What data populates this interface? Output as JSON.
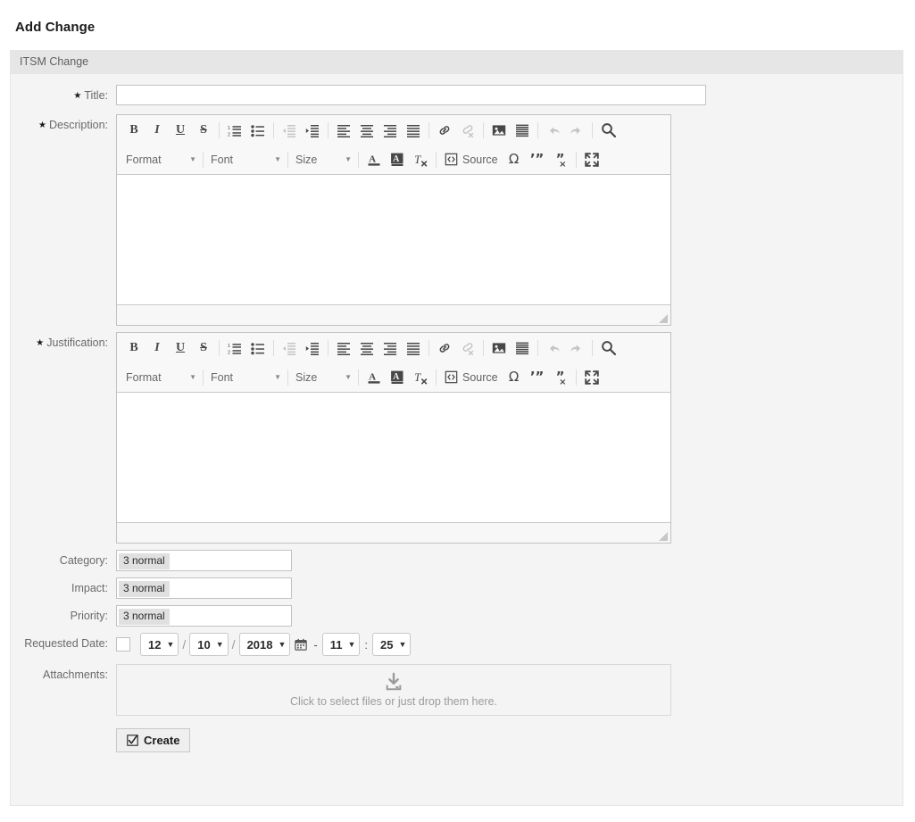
{
  "page": {
    "title": "Add Change"
  },
  "panel": {
    "header": "ITSM Change"
  },
  "fields": {
    "title": {
      "label": "Title:",
      "required": true,
      "value": "",
      "placeholder": ""
    },
    "description": {
      "label": "Description:",
      "required": true,
      "value": ""
    },
    "justification": {
      "label": "Justification:",
      "required": true,
      "value": ""
    },
    "category": {
      "label": "Category:",
      "required": false,
      "selected": "3 normal"
    },
    "impact": {
      "label": "Impact:",
      "required": false,
      "selected": "3 normal"
    },
    "priority": {
      "label": "Priority:",
      "required": false,
      "selected": "3 normal"
    },
    "requested_date": {
      "label": "Requested Date:",
      "checked": false,
      "month": "12",
      "day": "10",
      "year": "2018",
      "hour": "11",
      "minute": "25",
      "slash": "/",
      "dash": "-",
      "colon": ":"
    },
    "attachments": {
      "label": "Attachments:",
      "drop_text": "Click to select files or just drop them here."
    }
  },
  "buttons": {
    "create": "Create"
  },
  "editor_toolbar": {
    "row1": [
      {
        "name": "bold-icon",
        "kind": "text",
        "glyph": "B",
        "style": "bold",
        "disabled": false
      },
      {
        "name": "italic-icon",
        "kind": "text",
        "glyph": "I",
        "style": "ital",
        "disabled": false
      },
      {
        "name": "underline-icon",
        "kind": "text",
        "glyph": "U",
        "style": "und",
        "disabled": false
      },
      {
        "name": "strikethrough-icon",
        "kind": "text",
        "glyph": "S",
        "style": "strike",
        "disabled": false
      },
      {
        "name": "separator",
        "kind": "sep"
      },
      {
        "name": "numbered-list-icon",
        "kind": "svg",
        "shape": "ol",
        "disabled": false
      },
      {
        "name": "bulleted-list-icon",
        "kind": "svg",
        "shape": "ul",
        "disabled": false
      },
      {
        "name": "separator",
        "kind": "sep"
      },
      {
        "name": "decrease-indent-icon",
        "kind": "svg",
        "shape": "outdent",
        "disabled": true
      },
      {
        "name": "increase-indent-icon",
        "kind": "svg",
        "shape": "indent",
        "disabled": false
      },
      {
        "name": "separator",
        "kind": "sep"
      },
      {
        "name": "align-left-icon",
        "kind": "svg",
        "shape": "align-left",
        "disabled": false
      },
      {
        "name": "align-center-icon",
        "kind": "svg",
        "shape": "align-center",
        "disabled": false
      },
      {
        "name": "align-right-icon",
        "kind": "svg",
        "shape": "align-right",
        "disabled": false
      },
      {
        "name": "align-justify-icon",
        "kind": "svg",
        "shape": "align-justify",
        "disabled": false
      },
      {
        "name": "separator",
        "kind": "sep"
      },
      {
        "name": "link-icon",
        "kind": "svg",
        "shape": "link",
        "disabled": false
      },
      {
        "name": "unlink-icon",
        "kind": "svg",
        "shape": "unlink",
        "disabled": true
      },
      {
        "name": "separator",
        "kind": "sep"
      },
      {
        "name": "image-icon",
        "kind": "svg",
        "shape": "image",
        "disabled": false
      },
      {
        "name": "horizontal-rule-icon",
        "kind": "svg",
        "shape": "hr",
        "disabled": false
      },
      {
        "name": "separator",
        "kind": "sep"
      },
      {
        "name": "undo-icon",
        "kind": "svg",
        "shape": "undo",
        "disabled": true
      },
      {
        "name": "redo-icon",
        "kind": "svg",
        "shape": "redo",
        "disabled": true
      },
      {
        "name": "separator",
        "kind": "sep"
      },
      {
        "name": "find-icon",
        "kind": "svg",
        "shape": "search",
        "disabled": false
      }
    ],
    "row2": [
      {
        "name": "format-dropdown",
        "kind": "combo",
        "label": "Format",
        "cls": "format"
      },
      {
        "name": "separator",
        "kind": "sep"
      },
      {
        "name": "font-dropdown",
        "kind": "combo",
        "label": "Font",
        "cls": "font"
      },
      {
        "name": "separator",
        "kind": "sep"
      },
      {
        "name": "size-dropdown",
        "kind": "combo",
        "label": "Size",
        "cls": "size"
      },
      {
        "name": "separator",
        "kind": "sep"
      },
      {
        "name": "text-color-icon",
        "kind": "svg",
        "shape": "text-color",
        "disabled": false
      },
      {
        "name": "background-color-icon",
        "kind": "svg",
        "shape": "bg-color",
        "disabled": false
      },
      {
        "name": "remove-format-icon",
        "kind": "svg",
        "shape": "remove-format",
        "disabled": false
      },
      {
        "name": "separator",
        "kind": "sep"
      },
      {
        "name": "source-button",
        "kind": "source",
        "label": "Source"
      },
      {
        "name": "special-character-icon",
        "kind": "svg",
        "shape": "omega",
        "disabled": false
      },
      {
        "name": "blockquote-icon",
        "kind": "svg",
        "shape": "quote-open",
        "disabled": false
      },
      {
        "name": "remove-quote-icon",
        "kind": "svg",
        "shape": "quote-close",
        "disabled": false
      },
      {
        "name": "separator",
        "kind": "sep"
      },
      {
        "name": "maximize-icon",
        "kind": "svg",
        "shape": "maximize",
        "disabled": false
      }
    ]
  },
  "colors": {
    "panel_bg": "#f4f4f4",
    "panel_header_bg": "#e6e6e6",
    "border": "#c2c2c2",
    "label_text": "#6a6a6a",
    "icon": "#474747",
    "icon_disabled": "#c4c4c4"
  }
}
